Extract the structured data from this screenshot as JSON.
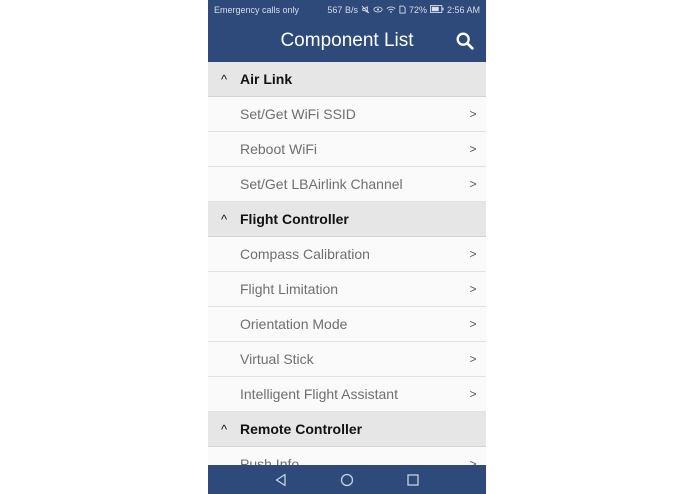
{
  "status_bar": {
    "carrier": "Emergency calls only",
    "network_speed": "567 B/s",
    "battery": "72%",
    "time": "2:56 AM",
    "icons": [
      "mute-icon",
      "eye-icon",
      "wifi-icon",
      "sim-icon",
      "battery-icon"
    ]
  },
  "app_bar": {
    "title": "Component List",
    "search_icon": "search-icon"
  },
  "groups": [
    {
      "caret": "^",
      "title": "Air Link",
      "items": [
        {
          "label": "Set/Get WiFi SSID",
          "chevron": ">"
        },
        {
          "label": "Reboot WiFi",
          "chevron": ">"
        },
        {
          "label": "Set/Get LBAirlink Channel",
          "chevron": ">"
        }
      ]
    },
    {
      "caret": "^",
      "title": "Flight Controller",
      "items": [
        {
          "label": "Compass Calibration",
          "chevron": ">"
        },
        {
          "label": "Flight Limitation",
          "chevron": ">"
        },
        {
          "label": "Orientation Mode",
          "chevron": ">"
        },
        {
          "label": "Virtual Stick",
          "chevron": ">"
        },
        {
          "label": "Intelligent Flight Assistant",
          "chevron": ">"
        }
      ]
    },
    {
      "caret": "^",
      "title": "Remote Controller",
      "items": [
        {
          "label": "Push Info",
          "chevron": ">"
        }
      ]
    }
  ],
  "nav_bar": {
    "buttons": [
      "back-icon",
      "home-icon",
      "recents-icon"
    ]
  },
  "colors": {
    "primary": "#2d4a7a",
    "header_bg": "#e6e6e6",
    "item_bg": "#fafafa",
    "item_text": "#6f6f6f"
  }
}
